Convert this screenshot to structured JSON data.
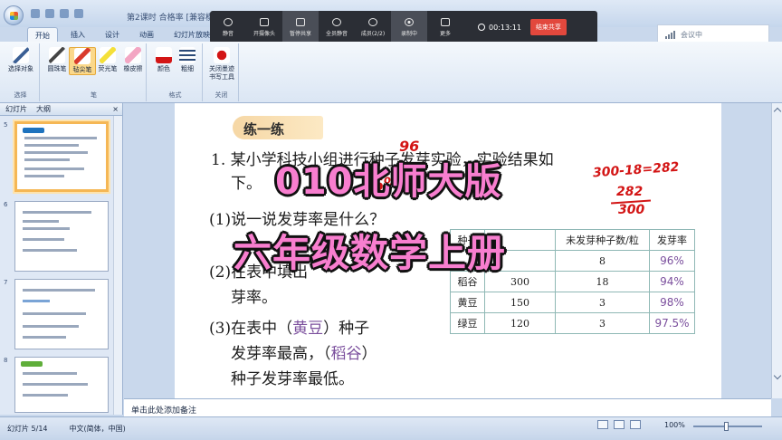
{
  "window": {
    "title": "第2课时 合格率 [兼容模式] - Microsoft PowerPoint"
  },
  "meeting_toolbar": {
    "items": [
      {
        "label": "静音",
        "icon": "microphone-icon"
      },
      {
        "label": "开摄像头",
        "icon": "camera-icon"
      },
      {
        "label": "暂停共享",
        "icon": "pause-share-icon"
      },
      {
        "label": "全员静音",
        "icon": "mute-all-icon"
      },
      {
        "label": "成员(2/2)",
        "icon": "members-icon"
      },
      {
        "label": "录制中",
        "icon": "record-icon"
      },
      {
        "label": "更多",
        "icon": "more-icon"
      }
    ],
    "timer": "00:13:11",
    "end_share": "结束共享",
    "status": "会议中"
  },
  "ribbon": {
    "tabs": [
      "开始",
      "插入",
      "设计",
      "动画",
      "幻灯片放映"
    ],
    "groups": [
      {
        "label": "选择",
        "buttons": [
          "选择对象"
        ]
      },
      {
        "label": "笔",
        "buttons": [
          "圆珠笔",
          "毡尖笔",
          "荧光笔",
          "橡皮擦"
        ]
      },
      {
        "label": "格式",
        "buttons": [
          "颜色",
          "粗细"
        ]
      },
      {
        "label": "关闭",
        "buttons": [
          "关闭墨迹书写工具"
        ]
      }
    ]
  },
  "slide_pane": {
    "tabs": [
      "幻灯片",
      "大纲"
    ],
    "thumb_numbers": [
      "5",
      "6",
      "7",
      "8"
    ]
  },
  "slide": {
    "banner": "练一练",
    "q1_line1": "1. 某小学科技小组进行种子发芽实验，实验结果如",
    "q1_line2": "下。",
    "sub1": "(1)说一说发芽率是什么？",
    "sub2_line1": "(2)在表中填出",
    "sub2_line2": "芽率。",
    "sub3_line1_a": "(3)在表中（",
    "sub3_ans1": "黄豆",
    "sub3_line1_b": "）种子",
    "sub3_line2_a": "发芽率最高，（",
    "sub3_ans2": "稻谷",
    "sub3_line2_b": "）",
    "sub3_line3": "种子发芽率最低。",
    "table": {
      "headers": [
        "种子",
        "",
        "未发芽种子数/粒",
        "发芽率"
      ],
      "rows": [
        {
          "name": "",
          "total": "",
          "not_sprouted": "8",
          "rate": "96%"
        },
        {
          "name": "稻谷",
          "total": "300",
          "not_sprouted": "18",
          "rate": "94%"
        },
        {
          "name": "黄豆",
          "total": "150",
          "not_sprouted": "3",
          "rate": "98%"
        },
        {
          "name": "绿豆",
          "total": "120",
          "not_sprouted": "3",
          "rate": "97.5%"
        }
      ]
    },
    "handwriting": {
      "top": "96",
      "left": "96%",
      "calc1": "300-18=282",
      "calc2": "282",
      "calc3": "300"
    }
  },
  "overlay": {
    "line1": "010北师大版",
    "line2": "六年级数学上册"
  },
  "notes_placeholder": "单击此处添加备注",
  "statusbar": {
    "slide_info": "幻灯片 5/14",
    "language": "中文(简体，中国)",
    "zoom": "100%"
  }
}
